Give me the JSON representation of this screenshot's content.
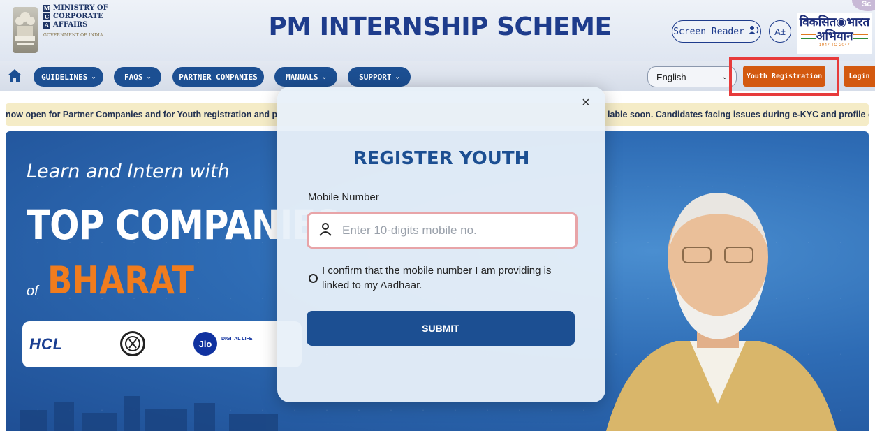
{
  "header": {
    "ministry_lines": [
      "MINISTRY OF",
      "CORPORATE",
      "AFFAIRS"
    ],
    "ministry_initials": [
      "M",
      "C",
      "A"
    ],
    "government": "GOVERNMENT OF INDIA",
    "site_title": "PM INTERNSHIP SCHEME",
    "screen_reader_label": "Screen Reader",
    "font_size_label": "A±",
    "viksit_line1": "विकसित◉भारत",
    "viksit_line2": "अभियान",
    "viksit_years": "1947 TO 2047",
    "corner_badge": "Sc"
  },
  "nav": {
    "items": [
      {
        "label": "GUIDELINES",
        "dropdown": true
      },
      {
        "label": "FAQS",
        "dropdown": true
      },
      {
        "label": "PARTNER COMPANIES",
        "dropdown": false
      },
      {
        "label": "MANUALS",
        "dropdown": true
      },
      {
        "label": "SUPPORT",
        "dropdown": true
      }
    ],
    "language": "English",
    "youth_registration": "Youth Registration",
    "login": "Login"
  },
  "ticker": {
    "text_left": "now open for Partner Companies and for Youth registration and p",
    "text_right": "lable soon. Candidates facing issues during e-KYC and profile cr"
  },
  "hero": {
    "line1": "Learn and Intern with",
    "line2": "TOP COMPANIES",
    "of": "of",
    "bharat": "BHARAT",
    "logos": {
      "hcl": "HCL",
      "jio": "Jio",
      "jio_sub": "DIGITAL LIFE"
    }
  },
  "modal": {
    "close": "×",
    "title": "REGISTER YOUTH",
    "mobile_label": "Mobile Number",
    "mobile_placeholder": "Enter 10-digits mobile no.",
    "mobile_value": "",
    "confirm_text": "I confirm that the mobile number I am providing is linked to my Aadhaar.",
    "submit": "SUBMIT"
  },
  "colors": {
    "brand_blue": "#1c4f92",
    "accent_orange": "#d3590f",
    "highlight_red": "#e73b3b",
    "ticker_bg": "#f5ecc7"
  },
  "icons": [
    "home-icon",
    "chevron-down-icon",
    "speaker-icon",
    "user-icon",
    "close-icon"
  ]
}
